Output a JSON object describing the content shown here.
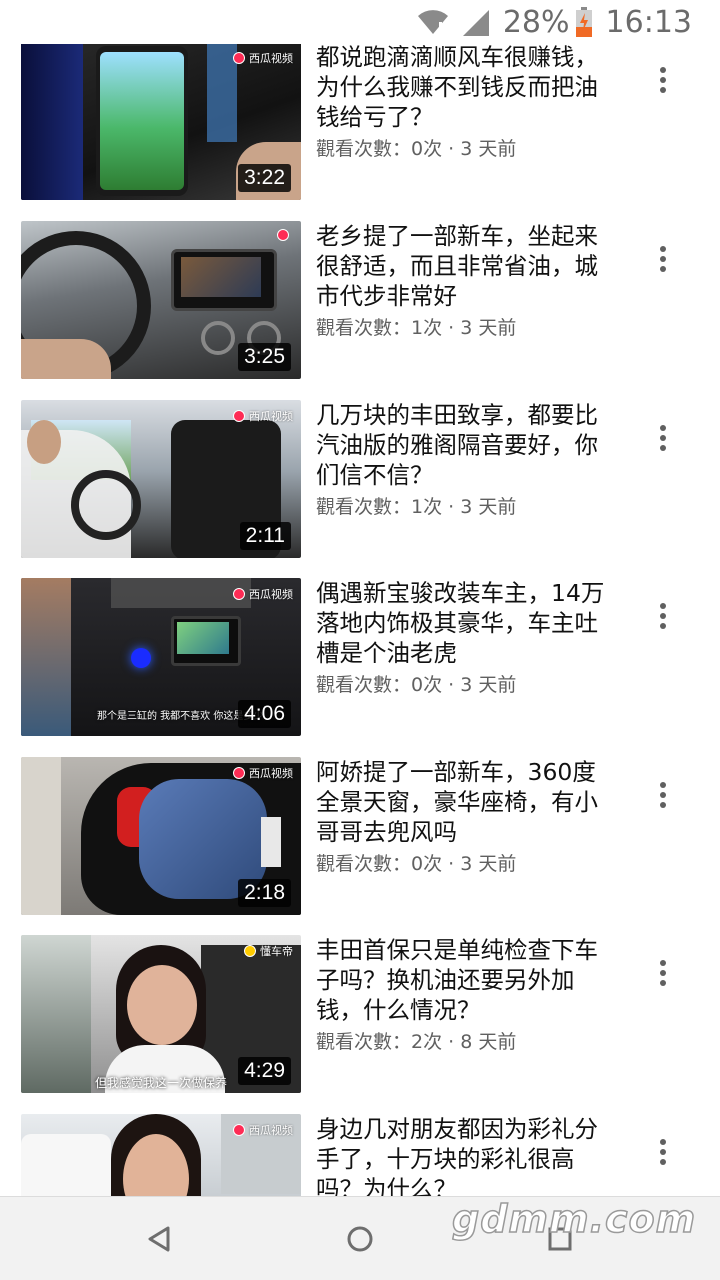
{
  "status_bar": {
    "battery_percent": "28%",
    "time": "16:13",
    "icons": [
      "wifi-off-icon",
      "cell-signal-icon",
      "battery-charging-icon"
    ]
  },
  "videos": [
    {
      "title": "都说跑滴滴顺风车很赚钱，为什么我赚不到钱反而把油钱给亏了？",
      "meta": "觀看次數：0次 · 3 天前",
      "duration": "3:22",
      "watermark": "西瓜视频"
    },
    {
      "title": "老乡提了一部新车，坐起来很舒适，而且非常省油，城市代步非常好",
      "meta": "觀看次數：1次 · 3 天前",
      "duration": "3:25",
      "watermark": ""
    },
    {
      "title": "几万块的丰田致享，都要比汽油版的雅阁隔音要好，你们信不信？",
      "meta": "觀看次數：1次 · 3 天前",
      "duration": "2:11",
      "watermark": "西瓜视频"
    },
    {
      "title": "偶遇新宝骏改装车主，14万落地内饰极其豪华，车主吐槽是个油老虎",
      "meta": "觀看次數：0次 · 3 天前",
      "duration": "4:06",
      "watermark": "西瓜视频",
      "subtitle": "那个是三缸的 我都不喜欢 你这是多少"
    },
    {
      "title": "阿娇提了一部新车，360度全景天窗，豪华座椅，有小哥哥去兜风吗",
      "meta": "觀看次數：0次 · 3 天前",
      "duration": "2:18",
      "watermark": "西瓜视频"
    },
    {
      "title": "丰田首保只是单纯检查下车子吗？换机油还要另外加钱，什么情况？",
      "meta": "觀看次數：2次 · 8 天前",
      "duration": "4:29",
      "watermark": "懂车帝",
      "subtitle": "但我感觉我这一次做保养"
    },
    {
      "title": "身边几对朋友都因为彩礼分手了，十万块的彩礼很高吗？为什么？",
      "meta": "",
      "duration": "",
      "watermark": "西瓜视频"
    }
  ],
  "nav_bar": {
    "buttons": [
      "back-icon",
      "home-icon",
      "recents-icon"
    ]
  },
  "overlay_watermark": "gdmm.com"
}
